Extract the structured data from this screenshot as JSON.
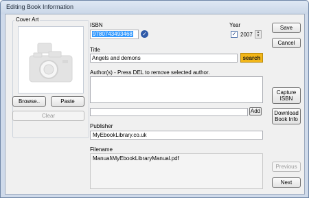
{
  "window": {
    "title": "Editing Book Information"
  },
  "cover": {
    "label": "Cover Art",
    "browse_label": "Browse..",
    "paste_label": "Paste",
    "clear_label": "Clear"
  },
  "isbn": {
    "label": "ISBN",
    "value": "9780743493468"
  },
  "year": {
    "label": "Year",
    "checked": true,
    "value": "2007"
  },
  "title": {
    "label": "Title",
    "value": "Angels and demons",
    "search_label": "search"
  },
  "authors": {
    "label": "Author(s) - Press DEL to remove selected author.",
    "items": [],
    "add_value": "",
    "add_label": "Add"
  },
  "publisher": {
    "label": "Publisher",
    "value": "MyEbookLibrary.co.uk"
  },
  "filename": {
    "label": "Filename",
    "value": "Manual\\MyEbookLibraryManual.pdf"
  },
  "actions": {
    "save_label": "Save",
    "cancel_label": "Cancel",
    "capture_label": "Capture\nISBN",
    "download_label": "Download\nBook Info",
    "previous_label": "Previous",
    "next_label": "Next"
  }
}
